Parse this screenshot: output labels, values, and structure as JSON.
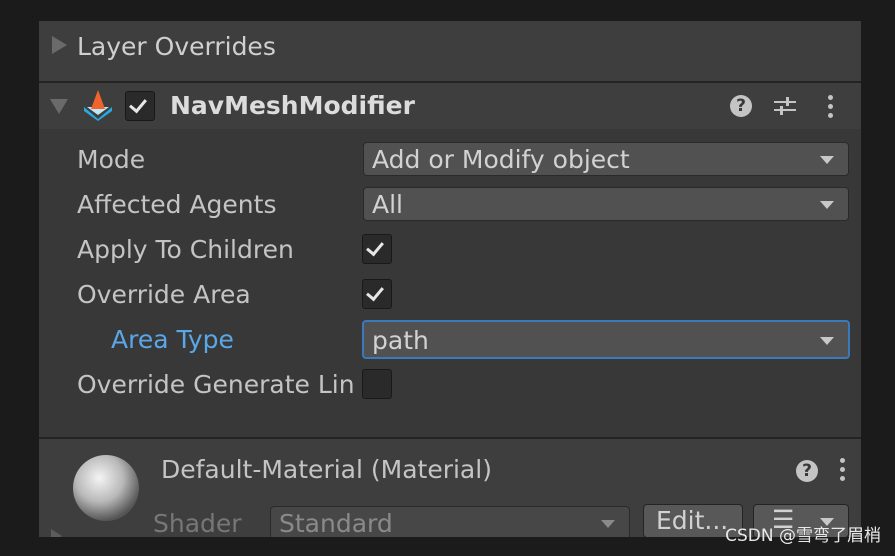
{
  "layer_overrides": {
    "title": "Layer Overrides"
  },
  "navmesh_modifier": {
    "title": "NavMeshModifier",
    "enabled": true,
    "fields": {
      "mode": {
        "label": "Mode",
        "value": "Add or Modify object"
      },
      "affected_agents": {
        "label": "Affected Agents",
        "value": "All"
      },
      "apply_to_children": {
        "label": "Apply To Children",
        "checked": true
      },
      "override_area": {
        "label": "Override Area",
        "checked": true
      },
      "area_type": {
        "label": "Area Type",
        "value": "path"
      },
      "override_generate_links": {
        "label": "Override Generate Links",
        "checked": false
      }
    },
    "header_icons": [
      "help-icon",
      "presets-icon",
      "more-icon"
    ]
  },
  "material": {
    "title": "Default-Material (Material)",
    "shader_label": "Shader",
    "shader_value": "Standard",
    "edit_label": "Edit...",
    "list_icon": "☰"
  },
  "colors": {
    "panel_bg": "#383838",
    "header_bg": "#3e3e3e",
    "field_bg": "#515151",
    "focus_blue": "#3a79bb",
    "highlight_label": "#5aa7e8",
    "icon_orange": "#f0632c",
    "icon_blue": "#29a9e1"
  },
  "watermark": "CSDN @雪弯了眉梢"
}
